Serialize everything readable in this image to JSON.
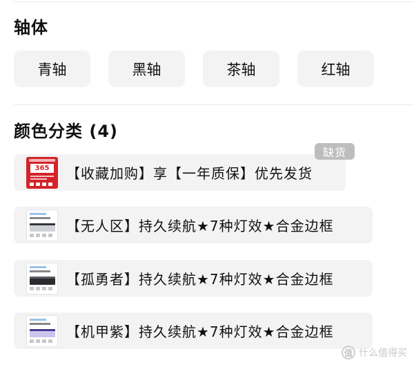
{
  "switch_section": {
    "title": "轴体",
    "options": [
      "青轴",
      "黑轴",
      "茶轴",
      "红轴"
    ]
  },
  "color_section": {
    "title": "颜色分类 (4)",
    "variants": [
      {
        "label": "【收藏加购】享【一年质保】优先发货",
        "thumb_text": "365",
        "thumb_icon": "promo-thumbnail"
      },
      {
        "label": "【无人区】持久续航★7种灯效★合金边框",
        "thumb_icon": "keyboard-white-thumbnail"
      },
      {
        "label": "【孤勇者】持久续航★7种灯效★合金边框",
        "thumb_icon": "keyboard-black-thumbnail"
      },
      {
        "label": "【机甲紫】持久续航★7种灯效★合金边框",
        "thumb_icon": "keyboard-purple-thumbnail"
      }
    ],
    "out_of_stock_badge": "缺货"
  },
  "watermark": {
    "icon_text": "值",
    "text": "什么值得买"
  },
  "colors": {
    "chip_bg": "#f3f3f3",
    "badge_bg": "#bdbdbd",
    "promo_red": "#d4232a"
  }
}
